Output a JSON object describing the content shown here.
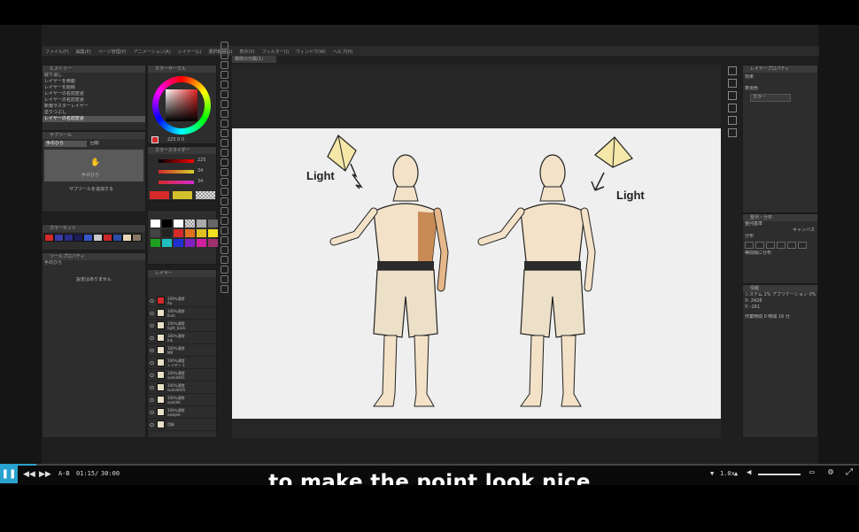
{
  "menu": [
    "ファイル(F)",
    "編集(E)",
    "ページ管理(P)",
    "アニメーション(A)",
    "レイヤー(L)",
    "選択範囲(S)",
    "表示(V)",
    "フィルター(I)",
    "ウィンドウ(W)",
    "ヘルプ(H)"
  ],
  "document_tab": "稿修の元稿(1)",
  "history": {
    "title": "ヒストリー",
    "items": [
      "取り消し",
      "レイヤーを移動",
      "レイヤーを削除",
      "レイヤーの名前変更",
      "レイヤーの名前変更",
      "新規ラスターレイヤー",
      "塗りつぶし",
      "レイヤーの名前変更"
    ],
    "selected_index": 7
  },
  "subtool": {
    "title": "サブツール",
    "tabs": [
      "手のひら",
      "回転"
    ],
    "item": "手のひら",
    "add_label": "サブツールを追加する"
  },
  "color_set_title": "カラーセット",
  "tool_property": {
    "title": "ツールプロパティ",
    "name": "手のひら",
    "empty": "設定はありません"
  },
  "color_wheel_title": "カラーサークル",
  "color_slider_title": "カラースライダー",
  "slider_values": [
    "225",
    "34",
    "34"
  ],
  "hsv_readout": "225 0 0",
  "layer_panel": {
    "title": "レイヤー",
    "items": [
      {
        "mode": "100％通常",
        "name": "Aa"
      },
      {
        "mode": "100％通常",
        "name": "Ilum"
      },
      {
        "mode": "100％通常",
        "name": "light_back"
      },
      {
        "mode": "100％通常",
        "name": "ink"
      },
      {
        "mode": "100％通常",
        "name": "MR"
      },
      {
        "mode": "100％通常",
        "name": "レイヤー 1"
      },
      {
        "mode": "100％通常",
        "name": "sumilet01"
      },
      {
        "mode": "100％通常",
        "name": "sumiletVS"
      },
      {
        "mode": "100％通常",
        "name": "sumilet"
      },
      {
        "mode": "100％通常",
        "name": "sample"
      },
      {
        "mode": "",
        "name": "用紙"
      }
    ]
  },
  "right_panel": {
    "title": "レイヤープロパティ",
    "effect": "効果",
    "expression": "表現色",
    "color_value": "カラー"
  },
  "align_panel": {
    "title": "整列・分布",
    "align": "整列基準",
    "align_value": "キャンバス",
    "spacing": "分布",
    "arrange": "等間隔に分布",
    "dist": "等間隔に分布"
  },
  "info_panel": {
    "title": "情報",
    "line1": "システム 1%  アプリケーション 0%",
    "line2": "X: 2428",
    "line3": "Y: -161",
    "line4": "作業時間     0 時間 16 分"
  },
  "canvas": {
    "light_left": "Light",
    "light_right": "Light"
  },
  "player": {
    "ab": "A-B",
    "current": "01:15",
    "separator": "/",
    "total": "30:00",
    "speed": "1.0x",
    "progress_fraction": 0.042,
    "volume_fraction": 1.0
  },
  "caption": "to make the point look nice"
}
